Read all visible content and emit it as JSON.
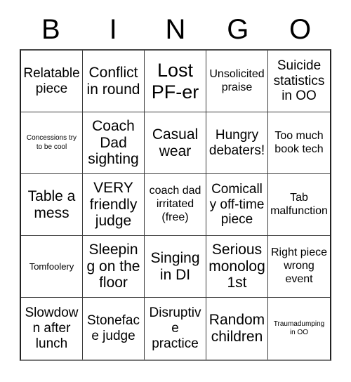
{
  "card": {
    "title_letters": [
      "B",
      "I",
      "N",
      "G",
      "O"
    ],
    "rows": 5,
    "columns": 5,
    "text_color": "#000000",
    "background_color": "#ffffff",
    "border_color": "#3a3a3a",
    "cells": [
      {
        "text": "Relatable piece",
        "size": "lg"
      },
      {
        "text": "Conflict in round",
        "size": "xl"
      },
      {
        "text": "Lost PF-er",
        "size": "xxl"
      },
      {
        "text": "Unsolicited praise",
        "size": "md"
      },
      {
        "text": "Suicide statistics in OO",
        "size": "lg"
      },
      {
        "text": "Concessions try to be cool",
        "size": "xs"
      },
      {
        "text": "Coach Dad sighting",
        "size": "xl"
      },
      {
        "text": "Casual wear",
        "size": "xl"
      },
      {
        "text": "Hungry debaters!",
        "size": "lg"
      },
      {
        "text": "Too much book tech",
        "size": "md"
      },
      {
        "text": "Table a mess",
        "size": "xl"
      },
      {
        "text": "VERY friendly judge",
        "size": "xl"
      },
      {
        "text": "coach dad irritated (free)",
        "size": "md"
      },
      {
        "text": "Comically off-time piece",
        "size": "lg"
      },
      {
        "text": "Tab malfunction",
        "size": "md"
      },
      {
        "text": "Tomfoolery",
        "size": "sm"
      },
      {
        "text": "Sleeping on the floor",
        "size": "xl"
      },
      {
        "text": "Singing in DI",
        "size": "xl"
      },
      {
        "text": "Serious monolog 1st",
        "size": "xl"
      },
      {
        "text": "Right piece wrong event",
        "size": "md"
      },
      {
        "text": "Slowdown after lunch",
        "size": "lg"
      },
      {
        "text": "Stoneface judge",
        "size": "lg"
      },
      {
        "text": "Disruptive practice",
        "size": "lg"
      },
      {
        "text": "Random children",
        "size": "xl"
      },
      {
        "text": "Traumadumping in OO",
        "size": "xs"
      }
    ]
  }
}
